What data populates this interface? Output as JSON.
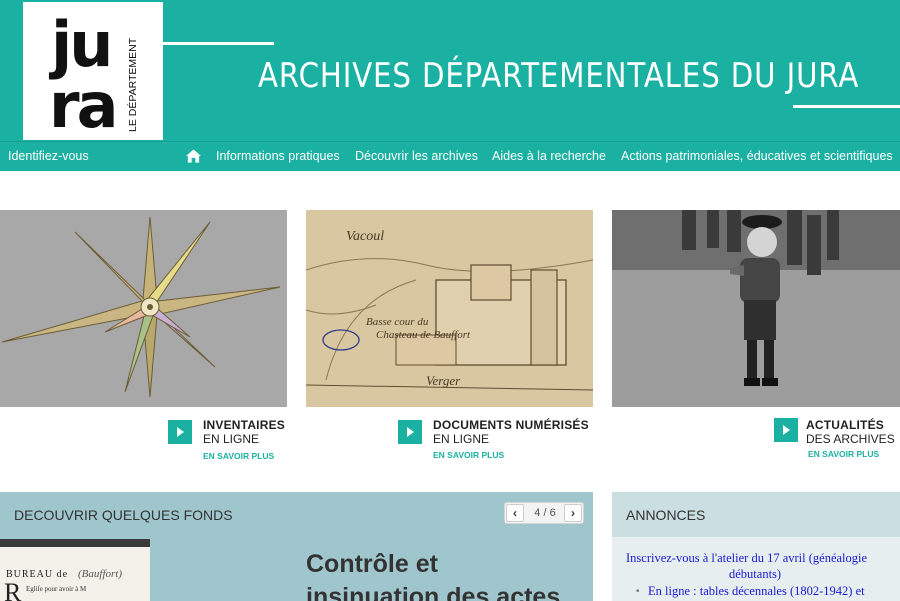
{
  "header": {
    "logo_text": "jura",
    "logo_sub": "LE DÉPARTEMENT",
    "site_title": "ARCHIVES DÉPARTEMENTALES DU JURA"
  },
  "nav": {
    "login": "Identifiez-vous",
    "home_icon": "home-icon",
    "items": [
      "Informations pratiques",
      "Découvrir les archives",
      "Aides à la recherche",
      "Actions patrimoniales, éducatives et scientifiques"
    ]
  },
  "cards": [
    {
      "title": "INVENTAIRES",
      "subtitle": "EN LIGNE",
      "more": "EN SAVOIR PLUS"
    },
    {
      "title": "DOCUMENTS NUMÉRISÉS",
      "subtitle": "EN LIGNE",
      "more": "EN SAVOIR PLUS"
    },
    {
      "title": "ACTUALITÉS",
      "subtitle": "DES ARCHIVES",
      "more": "EN SAVOIR PLUS"
    }
  ],
  "fonds": {
    "heading": "DECOUVRIR QUELQUES FONDS",
    "pager_text": "4 / 6",
    "prev": "‹",
    "next": "›",
    "title_line1": "Contrôle et",
    "title_line2": "insinuation des actes",
    "doc_text1": "BUREAU de",
    "doc_text2": "Egliſe pour avoir à M"
  },
  "annonces": {
    "heading": "ANNONCES",
    "line1": "Inscrivez-vous à l'atelier du 17 avril (généalogie",
    "line2": "débutants)",
    "line3": "En ligne : tables décennales (1802-1942) et"
  },
  "colors": {
    "accent": "#1bb1a2",
    "panel": "#9fc6cc",
    "link": "#1a1ad0"
  }
}
